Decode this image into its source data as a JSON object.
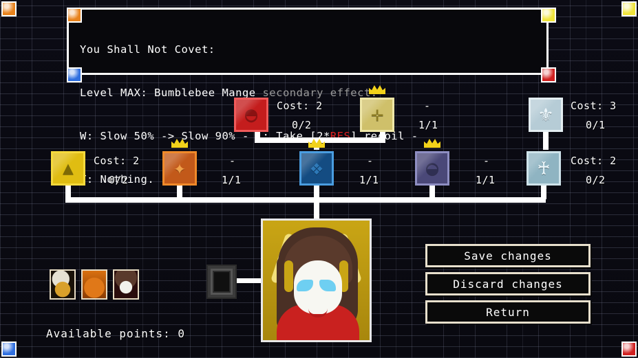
{
  "tooltip": {
    "title": "You Shall Not Covet:",
    "line2_main": "Level MAX: Bumblebee Mange ",
    "line2_dim": "secondary effect:",
    "line3_a": "W: Slow 50% -> Slow 90% - L: Take [2*",
    "line3_red": "RES",
    "line3_b": "] recoil -",
    "line4": "T: Nothing."
  },
  "nodes": {
    "red_orb": {
      "icon": "◓",
      "cost_label": "Cost: 2",
      "rank_label": "0/2",
      "crown": false,
      "border": "#f05a5a",
      "fill": "#c41d1d",
      "glyph": "#8a1212"
    },
    "gold_cross": {
      "icon": "✛",
      "cost_label": "-",
      "rank_label": "",
      "crown": true,
      "border": "#efe7a8",
      "fill": "#cfc06a",
      "glyph": "#8a7a22"
    },
    "white_cross": {
      "icon": "⚜",
      "cost_label": "Cost: 3",
      "rank_label": "0/1",
      "crown": false,
      "border": "#e4eef2",
      "fill": "#b6ccd6",
      "glyph": "#e9f4f8"
    },
    "yellow_moth": {
      "icon": "▲",
      "cost_label": "Cost: 2",
      "rank_label": "0/2",
      "crown": false,
      "border": "#f5d93c",
      "fill": "#e0bd12",
      "glyph": "#7e6a05"
    },
    "orange_orb": {
      "icon": "✦",
      "cost_label": "-",
      "rank_label": "1/1",
      "crown": true,
      "border": "#f08a2a",
      "fill": "#c2591a",
      "glyph": "#f0a14a"
    },
    "blue_orb": {
      "icon": "❖",
      "cost_label": "-",
      "rank_label": "1/1",
      "crown": true,
      "border": "#4a9de0",
      "fill": "#144c82",
      "glyph": "#2d79b8"
    },
    "purple_orb": {
      "icon": "◒",
      "cost_label": "-",
      "rank_label": "1/1",
      "crown": true,
      "border": "#8e8ec2",
      "fill": "#4a4878",
      "glyph": "#2f2f52"
    },
    "pale_tower": {
      "icon": "♰",
      "cost_label": "Cost: 2",
      "rank_label": "0/2",
      "crown": false,
      "border": "#cfe3ea",
      "fill": "#8fb4c2",
      "glyph": "#e7f3f7"
    }
  },
  "rank_top_right_gold": "1/1",
  "buttons": {
    "save": "Save changes",
    "discard": "Discard changes",
    "return": "Return"
  },
  "footer": {
    "points": "Available points: 0"
  },
  "party": [
    {
      "name": "party-portrait-1",
      "hair": "#e6e1d2",
      "skin": "#d9a02a",
      "bg": "#1a1208"
    },
    {
      "name": "party-portrait-2",
      "hair": "#e07818",
      "skin": "#d9700f",
      "bg": "#2a1505"
    },
    {
      "name": "party-portrait-3",
      "hair": "#5a3a2c",
      "skin": "#f2f2ec",
      "bg": "#2a0d0d"
    }
  ],
  "corner_gems": {
    "screen_tl": "#e8821c",
    "screen_tr": "#f0e43a",
    "screen_bl": "#2f6fe0",
    "screen_br": "#d02020",
    "tooltip_tl": "#e8821c",
    "tooltip_tr": "#f0e43a",
    "tooltip_bl": "#2f6fe0",
    "tooltip_br": "#d02020"
  }
}
